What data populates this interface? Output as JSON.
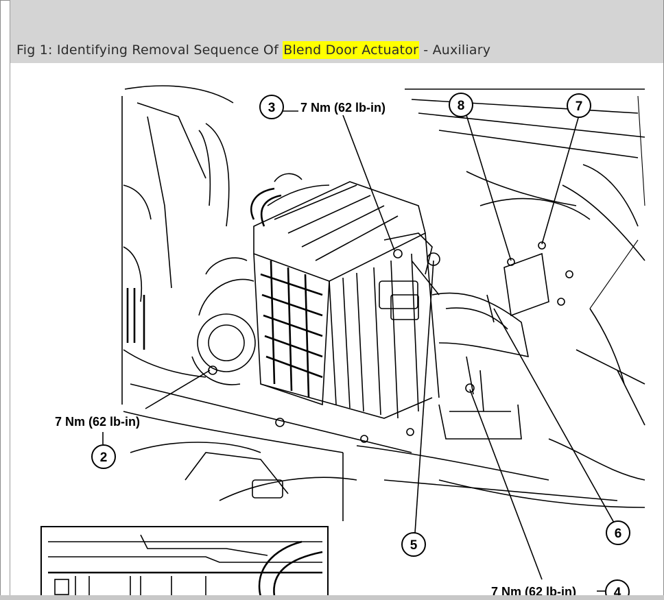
{
  "figure": {
    "caption_prefix": "Fig 1: Identifying Removal Sequence Of ",
    "caption_highlight": "Blend Door Actuator",
    "caption_suffix": " - Auxiliary",
    "highlight_color": "#ffff00"
  },
  "callouts": [
    {
      "id": "callout-2",
      "number": "2"
    },
    {
      "id": "callout-3",
      "number": "3"
    },
    {
      "id": "callout-4",
      "number": "4"
    },
    {
      "id": "callout-5",
      "number": "5"
    },
    {
      "id": "callout-6",
      "number": "6"
    },
    {
      "id": "callout-7",
      "number": "7"
    },
    {
      "id": "callout-8",
      "number": "8"
    }
  ],
  "torque_labels": {
    "top": "7 Nm (62 lb-in)",
    "left": "7 Nm (62 lb-in)",
    "bottom": "7 Nm (62 lb-in)"
  }
}
